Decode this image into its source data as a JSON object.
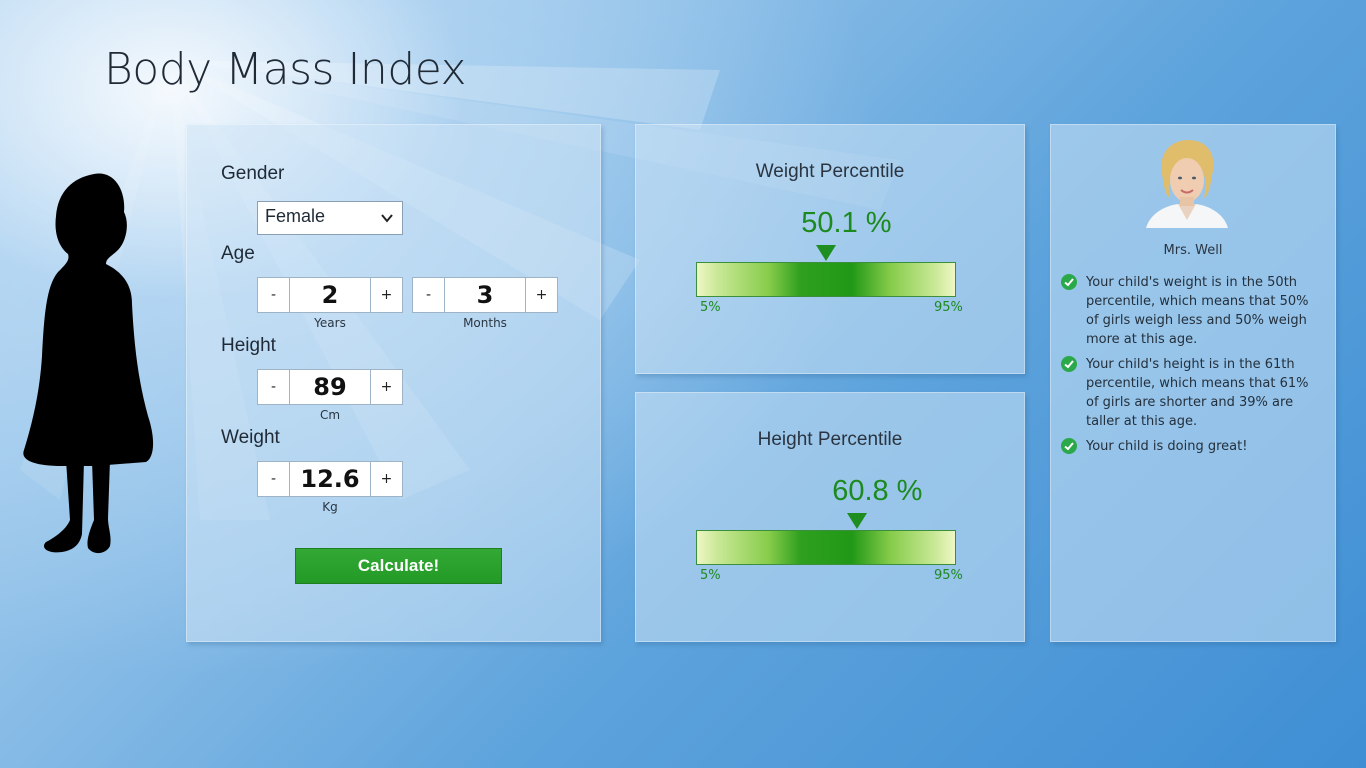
{
  "app": {
    "title": "Body Mass Index"
  },
  "input": {
    "gender_label": "Gender",
    "gender_value": "Female",
    "age_label": "Age",
    "years": {
      "minus": "-",
      "value": "2",
      "plus": "+",
      "unit": "Years"
    },
    "months": {
      "minus": "-",
      "value": "3",
      "plus": "+",
      "unit": "Months"
    },
    "height_label": "Height",
    "height": {
      "minus": "-",
      "value": "89",
      "plus": "+",
      "unit": "Cm"
    },
    "weight_label": "Weight",
    "weight": {
      "minus": "-",
      "value": "12.6",
      "plus": "+",
      "unit": "Kg"
    },
    "calculate_label": "Calculate!"
  },
  "weight_percentile": {
    "title": "Weight Percentile",
    "value_text": "50.1 %",
    "value": 50.1,
    "range_low": "5%",
    "range_high": "95%"
  },
  "height_percentile": {
    "title": "Height Percentile",
    "value_text": "60.8 %",
    "value": 60.8,
    "range_low": "5%",
    "range_high": "95%"
  },
  "advice": {
    "doctor_name": "Mrs. Well",
    "items": [
      "Your child's weight is in the 50th percentile, which means that 50% of girls weigh less and 50% weigh more at this age.",
      "Your child's height is in the 61th percentile, which means that 61% of girls are shorter and 39% are taller at this age.",
      "Your child is doing great!"
    ]
  },
  "colors": {
    "accent_green": "#1d8a1f",
    "button_green": "#2aa22c",
    "background_blue": "#5da3dc"
  }
}
